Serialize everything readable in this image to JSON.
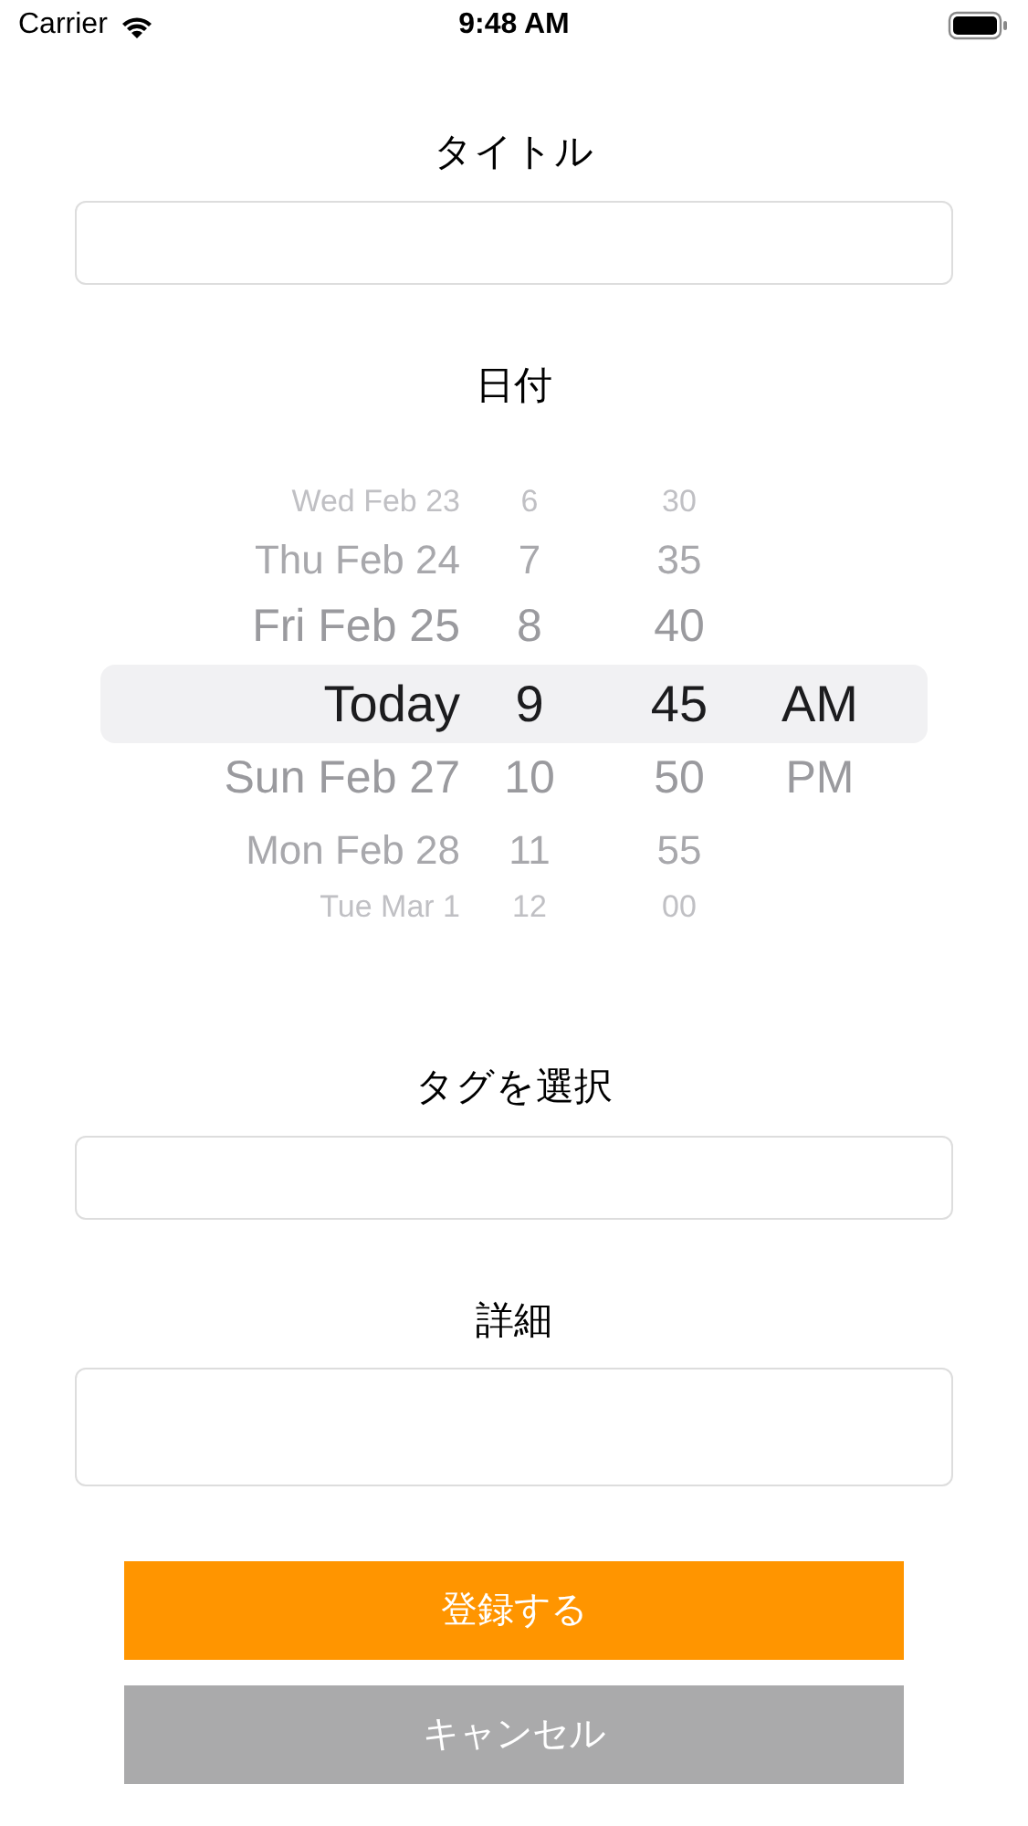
{
  "status_bar": {
    "carrier": "Carrier",
    "time": "9:48 AM"
  },
  "title_field": {
    "label": "タイトル"
  },
  "date_picker": {
    "label": "日付",
    "rows": [
      {
        "date": "Wed Feb 23",
        "hour": "6",
        "minute": "30",
        "selected": false
      },
      {
        "date": "Thu Feb 24",
        "hour": "7",
        "minute": "35",
        "selected": false
      },
      {
        "date": "Fri Feb 25",
        "hour": "8",
        "minute": "40",
        "selected": false
      },
      {
        "date": "Today",
        "hour": "9",
        "minute": "45",
        "period": "AM",
        "selected": true
      },
      {
        "date": "Sun Feb 27",
        "hour": "10",
        "minute": "50",
        "period": "PM",
        "selected": false
      },
      {
        "date": "Mon Feb 28",
        "hour": "11",
        "minute": "55",
        "selected": false
      },
      {
        "date": "Tue Mar 1",
        "hour": "12",
        "minute": "00",
        "selected": false
      }
    ]
  },
  "tag_field": {
    "label": "タグを選択"
  },
  "detail_field": {
    "label": "詳細"
  },
  "buttons": [
    {
      "label": "登録する",
      "kind": "primary"
    },
    {
      "label": "キャンセル",
      "kind": "secondary"
    }
  ]
}
